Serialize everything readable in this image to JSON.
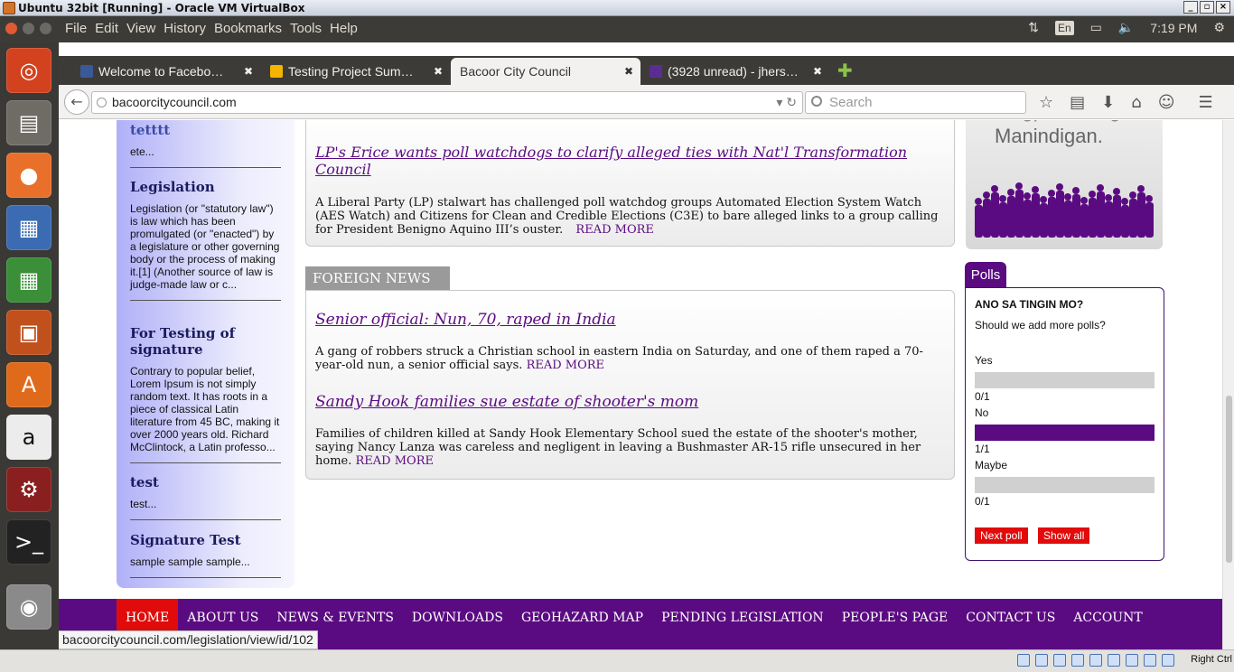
{
  "window": {
    "title": "Ubuntu 32bit [Running] - Oracle VM VirtualBox"
  },
  "menubar": {
    "items": [
      "File",
      "Edit",
      "View",
      "History",
      "Bookmarks",
      "Tools",
      "Help"
    ]
  },
  "indicators": {
    "lang": "En",
    "time": "7:19 PM"
  },
  "tabs": [
    {
      "label": "Welcome to Facebo…",
      "icon": "facebook-icon",
      "color": "#3b5998"
    },
    {
      "label": "Testing Project Sum…",
      "icon": "google-drive-icon",
      "color": "#f4b400"
    },
    {
      "label": "Bacoor City Council",
      "icon": "",
      "color": ""
    },
    {
      "label": "(3928 unread) - jhers…",
      "icon": "mail-icon",
      "color": "#5c2d91"
    }
  ],
  "urlbar": {
    "url": "bacoorcitycouncil.com",
    "search_placeholder": "Search"
  },
  "left_entries": [
    {
      "title": "tetttt",
      "body": "ete..."
    },
    {
      "title": "Legislation",
      "body": "Legislation (or \"statutory law\") is law which has been promulgated (or \"enacted\") by a legislature or other governing body or the process of making it.[1] (Another source of law is judge-made law or c..."
    },
    {
      "title": "For Testing of signature",
      "body": "Contrary to popular belief, Lorem Ipsum is not simply random text. It has roots in a piece of classical Latin literature from 45 BC, making it over 2000 years old. Richard McClintock, a Latin professo..."
    },
    {
      "title": "test",
      "body": "test..."
    },
    {
      "title": "Signature Test",
      "body": "sample sample sample..."
    }
  ],
  "top_news": {
    "title": "LP's Erice wants poll watchdogs to clarify alleged ties with Nat'l Transformation Council",
    "body": "A Liberal Party (LP) stalwart has challenged poll watchdog groups Automated Election System Watch (AES Watch) and Citizens for Clean and Credible Elections (C3E) to bare alleged links to a group calling for President Benigno Aquino III’s ouster.",
    "read_more": "READ MORE"
  },
  "foreign_news": {
    "heading": "FOREIGN NEWS",
    "items": [
      {
        "title": "Senior official: Nun, 70, raped in India",
        "body": "A gang of robbers struck a Christian school in eastern India on Saturday, and one of them raped a 70-year-old nun, a senior official says.",
        "read_more": "READ MORE"
      },
      {
        "title": "Sandy Hook families sue estate of shooter's mom",
        "body": "Families of children killed at Sandy Hook Elementary School sued the estate of the shooter's mother, saying Nancy Lanza was careless and negligent in leaving a Bushmaster AR-15 rifle unsecured in her home.",
        "read_more": "READ MORE"
      }
    ]
  },
  "banner": {
    "text": "Manindigan."
  },
  "polls": {
    "tab": "Polls",
    "heading": "ANO SA TINGIN MO?",
    "question": "Should we add more polls?",
    "options": [
      {
        "label": "Yes",
        "count": "0/1",
        "fraction": 0
      },
      {
        "label": "No",
        "count": "1/1",
        "fraction": 1
      },
      {
        "label": "Maybe",
        "count": "0/1",
        "fraction": 0
      }
    ],
    "next_label": "Next poll",
    "show_all_label": "Show all"
  },
  "footer_nav": [
    "HOME",
    "ABOUT US",
    "NEWS & EVENTS",
    "DOWNLOADS",
    "GEOHAZARD MAP",
    "PENDING LEGISLATION",
    "PEOPLE'S PAGE",
    "CONTACT US",
    "ACCOUNT"
  ],
  "status_url": "bacoorcitycouncil.com/legislation/view/id/102",
  "vbox_status": {
    "host_key": "Right Ctrl"
  },
  "colors": {
    "brand_purple": "#5b0b82",
    "home_red": "#e10b0b"
  }
}
